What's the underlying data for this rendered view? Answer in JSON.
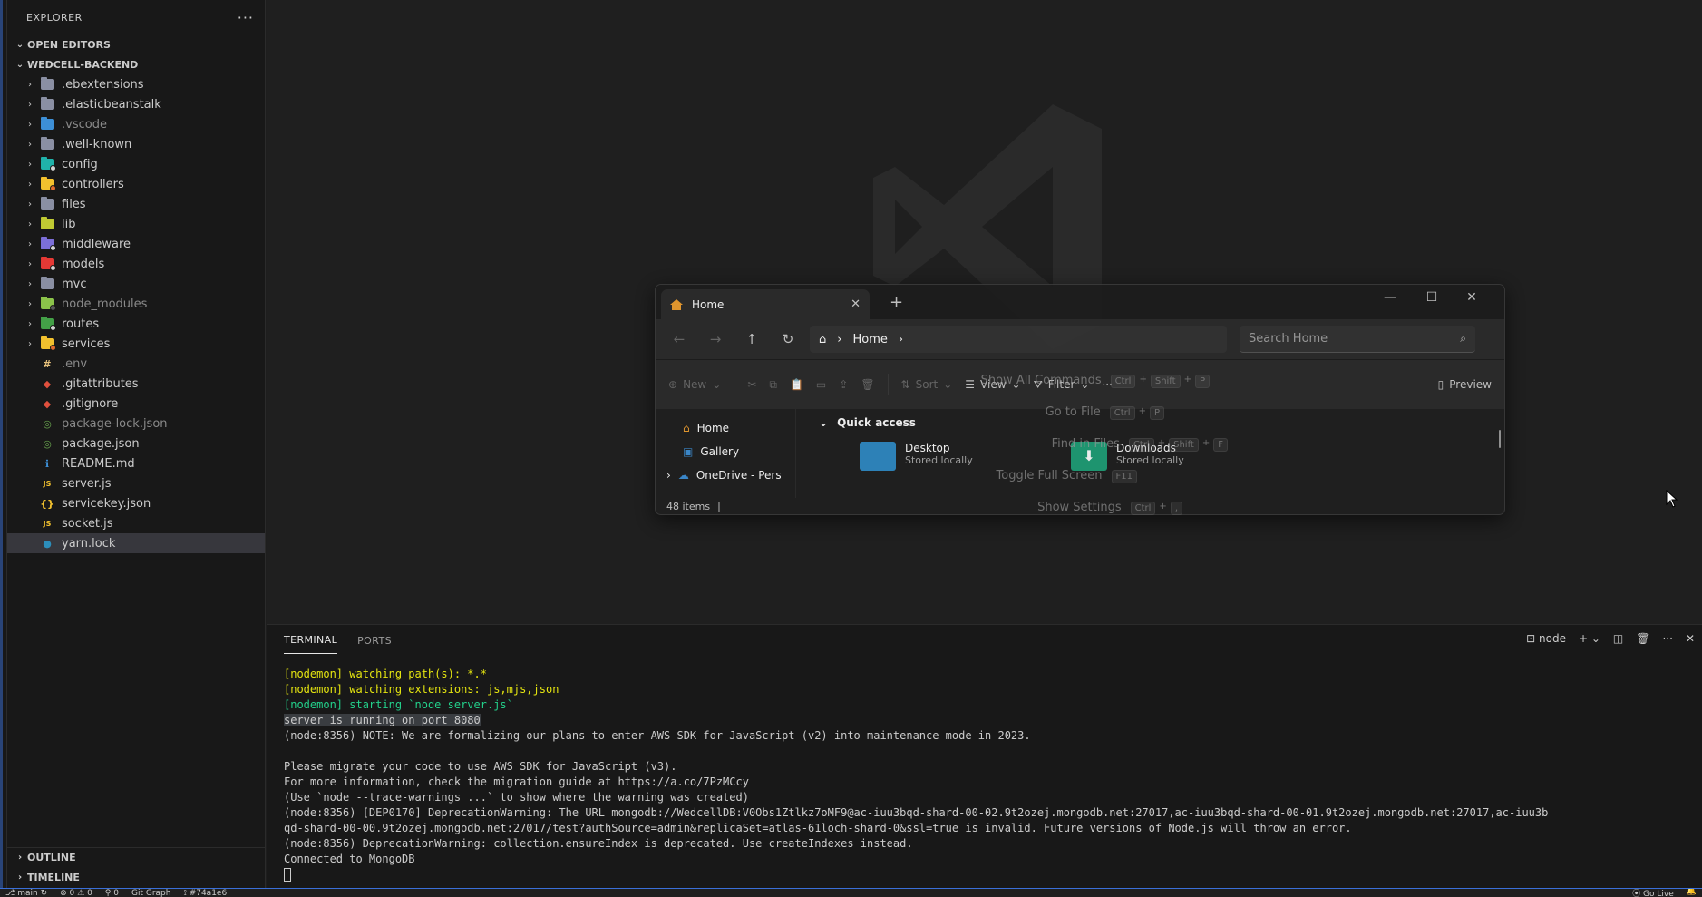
{
  "sidebar": {
    "header": "EXPLORER",
    "open_editors": "OPEN EDITORS",
    "project": "WEDCELL-BACKEND",
    "outline": "OUTLINE",
    "timeline": "TIMELINE",
    "items": [
      {
        "label": ".ebextensions",
        "type": "folder",
        "color": "#8a8fa3",
        "badge": ""
      },
      {
        "label": ".elasticbeanstalk",
        "type": "folder",
        "color": "#8a8fa3",
        "badge": ""
      },
      {
        "label": ".vscode",
        "type": "folder",
        "color": "#3d8fd6",
        "badge": "",
        "dim": true
      },
      {
        "label": ".well-known",
        "type": "folder",
        "color": "#8a8fa3",
        "badge": ""
      },
      {
        "label": "config",
        "type": "folder",
        "color": "#20b2aa",
        "badge": "#d4d4d4"
      },
      {
        "label": "controllers",
        "type": "folder",
        "color": "#f2c12e",
        "badge": "#e06c2e"
      },
      {
        "label": "files",
        "type": "folder",
        "color": "#8a8fa3",
        "badge": ""
      },
      {
        "label": "lib",
        "type": "folder",
        "color": "#c0ca33",
        "badge": ""
      },
      {
        "label": "middleware",
        "type": "folder",
        "color": "#7c6fd8",
        "badge": "#d4d4d4"
      },
      {
        "label": "models",
        "type": "folder",
        "color": "#e53935",
        "badge": "#d4d4d4"
      },
      {
        "label": "mvc",
        "type": "folder",
        "color": "#8a8fa3",
        "badge": ""
      },
      {
        "label": "node_modules",
        "type": "folder",
        "color": "#8bc34a",
        "badge": "#5a5a5a",
        "dim": true
      },
      {
        "label": "routes",
        "type": "folder",
        "color": "#43a047",
        "badge": "#d4d4d4"
      },
      {
        "label": "services",
        "type": "folder",
        "color": "#f2c12e",
        "badge": "#e06c2e"
      },
      {
        "label": ".env",
        "type": "file",
        "icon": "hash-icon",
        "glyph": "#",
        "color": "#e5c07b",
        "dim": true
      },
      {
        "label": ".gitattributes",
        "type": "file",
        "icon": "git-icon",
        "glyph": "◆",
        "color": "#e0503d"
      },
      {
        "label": ".gitignore",
        "type": "file",
        "icon": "git-icon",
        "glyph": "◆",
        "color": "#e0503d"
      },
      {
        "label": "package-lock.json",
        "type": "file",
        "icon": "npm-icon",
        "glyph": "◎",
        "color": "#6aa84f",
        "dim": true
      },
      {
        "label": "package.json",
        "type": "file",
        "icon": "npm-icon",
        "glyph": "◎",
        "color": "#6aa84f"
      },
      {
        "label": "README.md",
        "type": "file",
        "icon": "info-icon",
        "glyph": "ℹ",
        "color": "#3d8fd6"
      },
      {
        "label": "server.js",
        "type": "file",
        "icon": "js-icon",
        "glyph": "JS",
        "color": "#f2c12e"
      },
      {
        "label": "servicekey.json",
        "type": "file",
        "icon": "braces-icon",
        "glyph": "{}",
        "color": "#f2c12e"
      },
      {
        "label": "socket.js",
        "type": "file",
        "icon": "js-icon",
        "glyph": "JS",
        "color": "#f2c12e"
      },
      {
        "label": "yarn.lock",
        "type": "file",
        "icon": "yarn-icon",
        "glyph": "●",
        "color": "#2c8ebb",
        "selected": true
      }
    ]
  },
  "overlay_window": {
    "tab_title": "Home",
    "breadcrumb": "Home",
    "search_placeholder": "Search Home",
    "toolbar": {
      "new": "New",
      "view": "View",
      "filter": "Filter",
      "preview": "Preview"
    },
    "nav": [
      "Home",
      "Gallery",
      "OneDrive - Pers"
    ],
    "quick_access": "Quick access",
    "items": [
      {
        "name": "Desktop",
        "sub": "Stored locally",
        "color": "#2f8ac4"
      },
      {
        "name": "Downloads",
        "sub": "Stored locally",
        "color": "#1e9e76"
      }
    ],
    "status": "48 items"
  },
  "command_hints": [
    {
      "label": "Show All Commands",
      "keys": [
        "Ctrl",
        "+",
        "Shift",
        "+",
        "P"
      ]
    },
    {
      "label": "Go to File",
      "keys": [
        "Ctrl",
        "+",
        "P"
      ]
    },
    {
      "label": "Find in Files",
      "keys": [
        "Ctrl",
        "+",
        "Shift",
        "+",
        "F"
      ]
    },
    {
      "label": "Toggle Full Screen",
      "keys": [
        "F11"
      ]
    },
    {
      "label": "Show Settings",
      "keys": [
        "Ctrl",
        "+",
        ","
      ]
    }
  ],
  "overlay_sort": "Sort",
  "panel": {
    "tabs": [
      "TERMINAL",
      "PORTS"
    ],
    "shell": "node",
    "lines": [
      {
        "text": "[nodemon] watching path(s): *.*",
        "style": "yellow"
      },
      {
        "text": "[nodemon] watching extensions: js,mjs,json",
        "style": "yellow"
      },
      {
        "text": "[nodemon] starting `node server.js`",
        "style": "green"
      },
      {
        "text": "server is running on port 8080",
        "style": "hl"
      },
      {
        "text": "(node:8356) NOTE: We are formalizing our plans to enter AWS SDK for JavaScript (v2) into maintenance mode in 2023.",
        "style": ""
      },
      {
        "text": "",
        "style": ""
      },
      {
        "text": "Please migrate your code to use AWS SDK for JavaScript (v3).",
        "style": ""
      },
      {
        "text": "For more information, check the migration guide at https://a.co/7PzMCcy",
        "style": ""
      },
      {
        "text": "(Use `node --trace-warnings ...` to show where the warning was created)",
        "style": ""
      },
      {
        "text": "(node:8356) [DEP0170] DeprecationWarning: The URL mongodb://WedcellDB:V0Obs1Ztlkz7oMF9@ac-iuu3bqd-shard-00-02.9t2ozej.mongodb.net:27017,ac-iuu3bqd-shard-00-01.9t2ozej.mongodb.net:27017,ac-iuu3b",
        "style": ""
      },
      {
        "text": "qd-shard-00-00.9t2ozej.mongodb.net:27017/test?authSource=admin&replicaSet=atlas-61loch-shard-0&ssl=true is invalid. Future versions of Node.js will throw an error.",
        "style": ""
      },
      {
        "text": "(node:8356) DeprecationWarning: collection.ensureIndex is deprecated. Use createIndexes instead.",
        "style": ""
      },
      {
        "text": "Connected to MongoDB",
        "style": ""
      }
    ]
  },
  "statusbar": {
    "branch": "main",
    "problems": "0 ⚠ 0",
    "ports": "0",
    "git_graph": "Git Graph",
    "commit": "#74a1e6",
    "go_live": "Go Live"
  }
}
